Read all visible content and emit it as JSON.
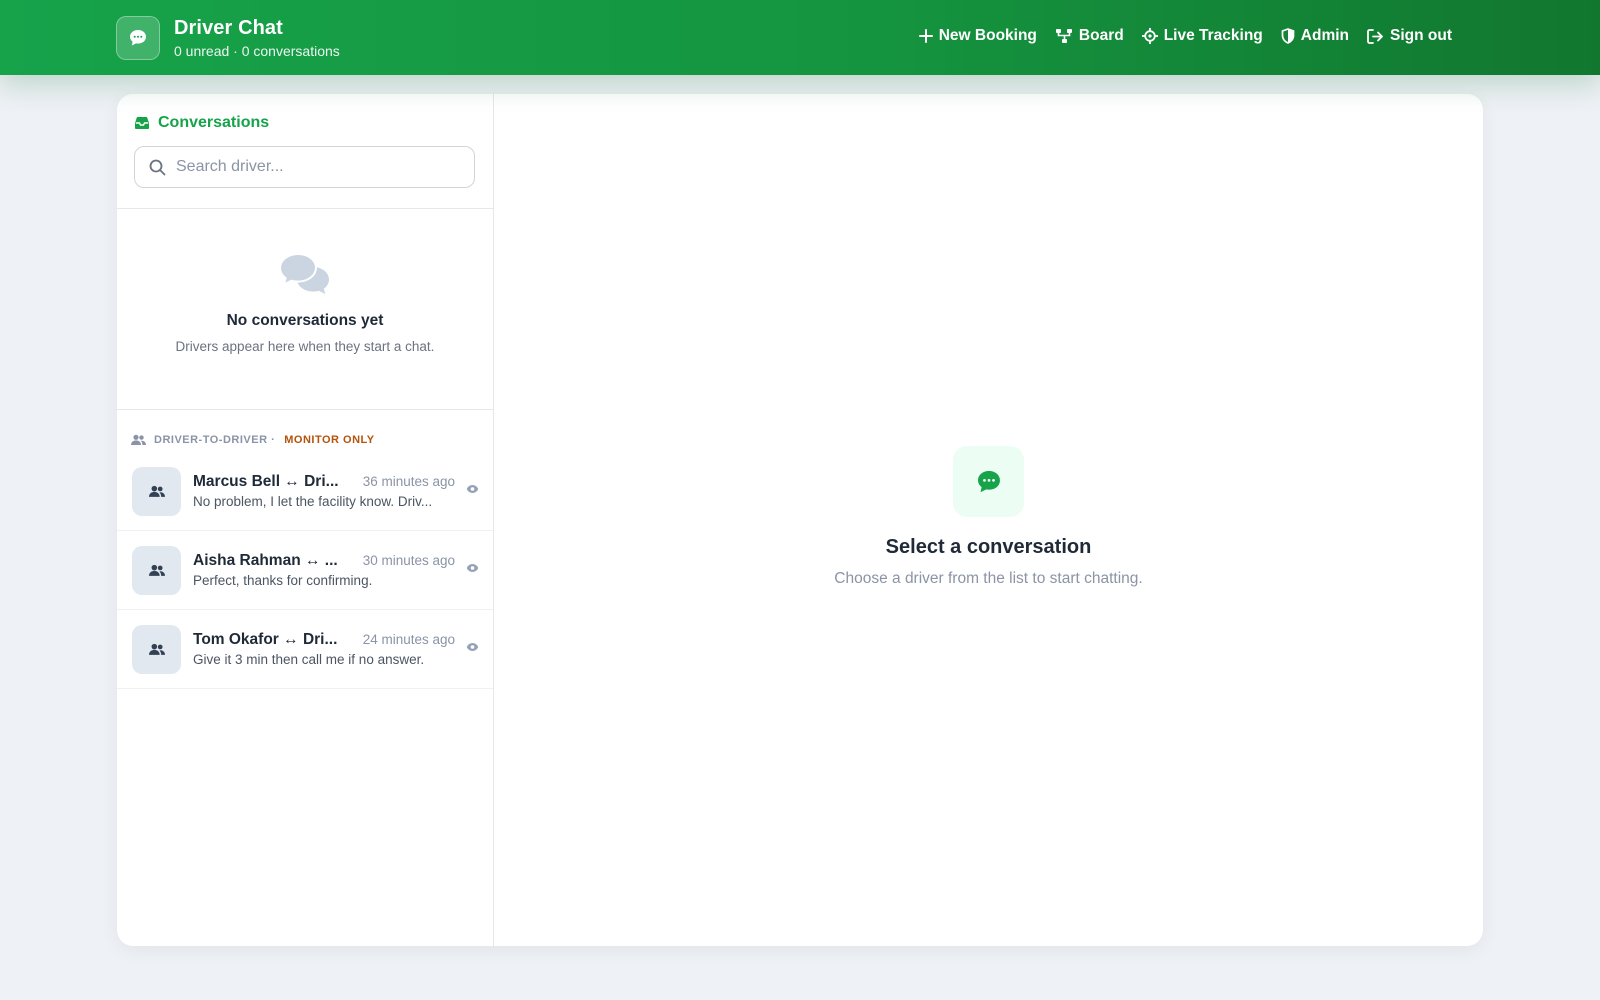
{
  "header": {
    "title": "Driver Chat",
    "subtitle": "0 unread · 0 conversations",
    "logo_icon": "chat-bubble-icon",
    "nav": [
      {
        "label": "New Booking",
        "icon": "plus-icon"
      },
      {
        "label": "Board",
        "icon": "board-icon"
      },
      {
        "label": "Live Tracking",
        "icon": "crosshair-icon"
      },
      {
        "label": "Admin",
        "icon": "shield-icon"
      },
      {
        "label": "Sign out",
        "icon": "sign-out-icon"
      }
    ]
  },
  "sidebar": {
    "title": "Conversations",
    "search_placeholder": "Search driver...",
    "empty_title": "No conversations yet",
    "empty_sub": "Drivers appear here when they start a chat.",
    "section_label": "DRIVER-TO-DRIVER ·",
    "section_badge": "MONITOR ONLY",
    "d2d": [
      {
        "name": "Marcus Bell ↔ Dri...",
        "time": "36 minutes ago",
        "preview": "No problem, I let the facility know. Driv..."
      },
      {
        "name": "Aisha Rahman ↔ ...",
        "time": "30 minutes ago",
        "preview": "Perfect, thanks for confirming."
      },
      {
        "name": "Tom Okafor ↔ Dri...",
        "time": "24 minutes ago",
        "preview": "Give it 3 min then call me if no answer."
      }
    ]
  },
  "main": {
    "title": "Select a conversation",
    "sub": "Choose a driver from the list to start chatting."
  },
  "colors": {
    "brand": "#16a34a",
    "brand_dark": "#11772f",
    "background": "#eef1f5",
    "monitor_badge": "#b45309"
  }
}
